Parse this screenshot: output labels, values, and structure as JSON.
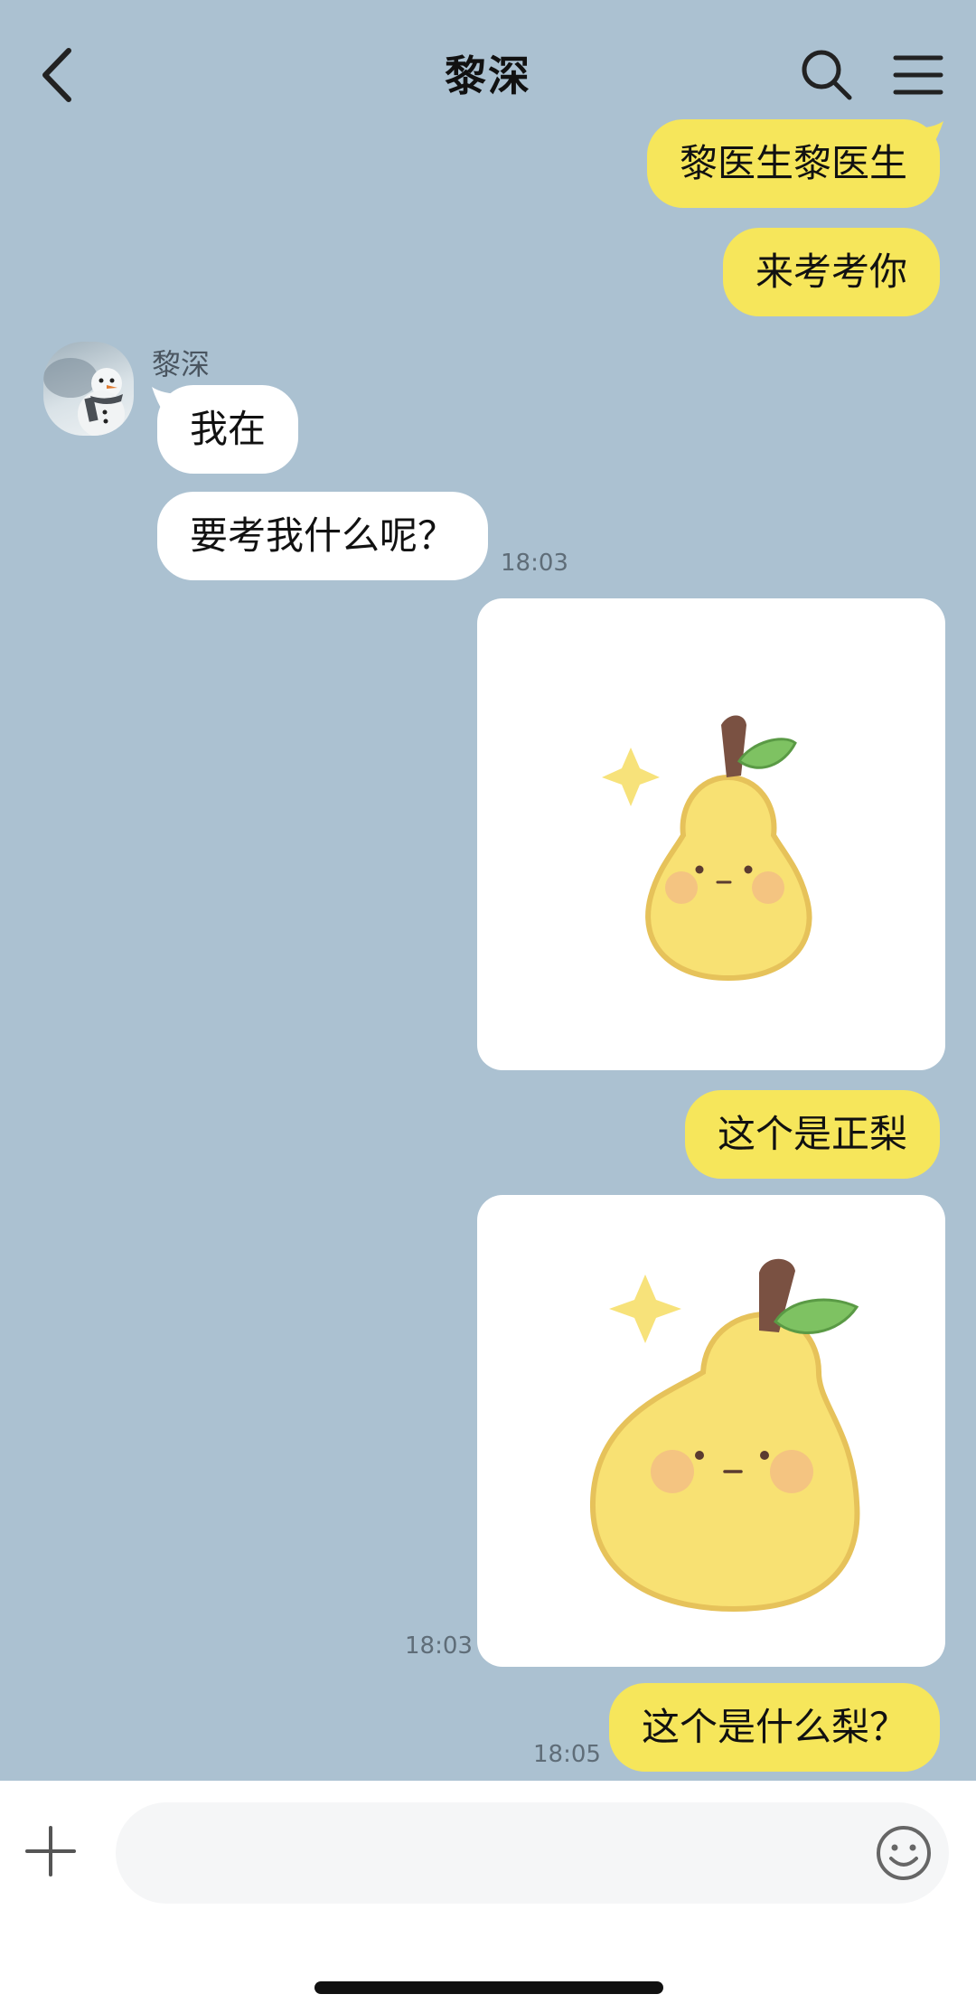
{
  "header": {
    "title": "黎深",
    "back_icon": "chevron-left-icon",
    "search_icon": "search-icon",
    "menu_icon": "hamburger-menu-icon"
  },
  "chat": {
    "contact_name": "黎深",
    "messages": [
      {
        "from": "me",
        "type": "text",
        "text": "黎医生黎医生"
      },
      {
        "from": "me",
        "type": "text",
        "text": "来考考你"
      },
      {
        "from": "contact",
        "type": "text",
        "text": "我在"
      },
      {
        "from": "contact",
        "type": "text",
        "text": "要考我什么呢？",
        "time": "18:03"
      },
      {
        "from": "me",
        "type": "sticker",
        "sticker": "pear-sticker"
      },
      {
        "from": "me",
        "type": "text",
        "text": "这个是正梨"
      },
      {
        "from": "me",
        "type": "sticker",
        "sticker": "pear-sticker",
        "time": "18:03"
      },
      {
        "from": "me",
        "type": "text",
        "text": "这个是什么梨？",
        "time": "18:05"
      }
    ]
  },
  "input": {
    "placeholder": "",
    "plus_icon": "plus-icon",
    "emoji_icon": "smiley-emoji-icon"
  },
  "colors": {
    "background": "#abc1d1",
    "outgoing_bubble": "#f6e65b",
    "incoming_bubble": "#ffffff"
  }
}
